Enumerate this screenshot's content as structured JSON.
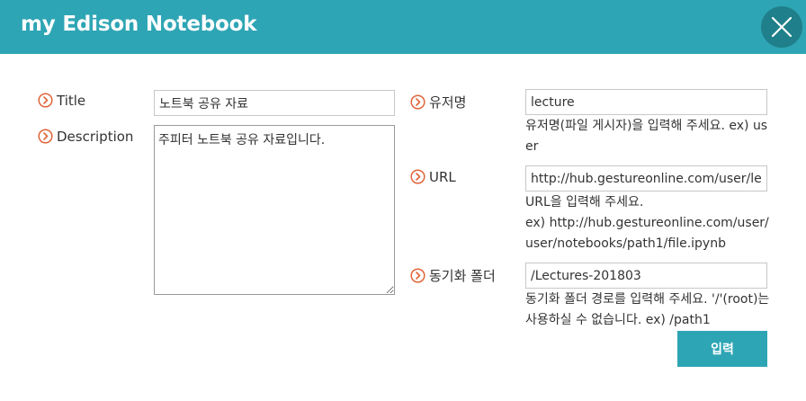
{
  "dialog": {
    "title": "my Edison Notebook",
    "accent_color": "#2ea5b4",
    "bullet_color": "#e0653a",
    "close_icon": "close-icon"
  },
  "left": {
    "title_label": "Title",
    "title_value": "노트북 공유 자료",
    "description_label": "Description",
    "description_value": "주피터 노트북 공유 자료입니다."
  },
  "right": {
    "username_label": "유저명",
    "username_value": "lecture",
    "username_help": "유저명(파일 게시자)을 입력해 주세요. ex) user",
    "url_label": "URL",
    "url_value": "http://hub.gestureonline.com/user/lecture/notebooks/file.ipynb",
    "url_help_1": "URL을 입력해 주세요.",
    "url_help_2": "ex) http://hub.gestureonline.com/user/user/notebooks/path1/file.ipynb",
    "folder_label": "동기화 폴더",
    "folder_value": "/Lectures-201803",
    "folder_help": "동기화 폴더 경로를 입력해 주세요. '/'(root)는 사용하실 수 없습니다. ex) /path1"
  },
  "actions": {
    "submit_label": "입력"
  }
}
